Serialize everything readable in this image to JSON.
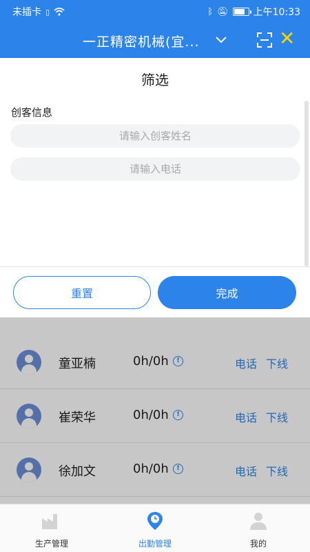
{
  "status_bar": {
    "carrier": "未插卡",
    "time": "上午10:33"
  },
  "header": {
    "title": "一正精密机械(宜...",
    "accent": "#2c84ea"
  },
  "filter": {
    "title": "筛选",
    "section_label": "创客信息",
    "name_placeholder": "请输入创客姓名",
    "phone_placeholder": "请输入电话",
    "reset_label": "重置",
    "done_label": "完成"
  },
  "list": {
    "rows": [
      {
        "name": "童亚楠",
        "hours": "0h/0h",
        "call": "电话",
        "offline": "下线"
      },
      {
        "name": "崔荣华",
        "hours": "0h/0h",
        "call": "电话",
        "offline": "下线"
      },
      {
        "name": "徐加文",
        "hours": "0h/0h",
        "call": "电话",
        "offline": "下线"
      }
    ]
  },
  "tabbar": {
    "items": [
      {
        "label": "生产管理",
        "icon": "factory-icon"
      },
      {
        "label": "出勤管理",
        "icon": "location-clock-icon"
      },
      {
        "label": "我的",
        "icon": "person-icon"
      }
    ],
    "active": 1
  }
}
